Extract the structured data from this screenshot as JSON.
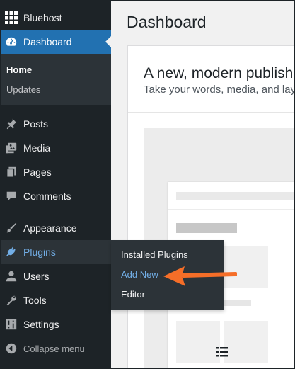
{
  "sidebar": {
    "top_item": {
      "label": "Bluehost",
      "icon": "grid-icon"
    },
    "dashboard": {
      "label": "Dashboard",
      "icon": "dashboard-gauge-icon"
    },
    "dashboard_sub": [
      {
        "label": "Home",
        "current": true
      },
      {
        "label": "Updates",
        "current": false
      }
    ],
    "items": [
      {
        "label": "Posts",
        "icon": "pin-icon"
      },
      {
        "label": "Media",
        "icon": "media-icon"
      },
      {
        "label": "Pages",
        "icon": "pages-icon"
      },
      {
        "label": "Comments",
        "icon": "comment-icon"
      },
      {
        "label": "Appearance",
        "icon": "paintbrush-icon"
      },
      {
        "label": "Plugins",
        "icon": "plug-icon"
      },
      {
        "label": "Users",
        "icon": "user-icon"
      },
      {
        "label": "Tools",
        "icon": "wrench-icon"
      },
      {
        "label": "Settings",
        "icon": "settings-icon"
      }
    ],
    "collapse": {
      "label": "Collapse menu",
      "icon": "collapse-icon"
    }
  },
  "flyout": {
    "items": [
      {
        "label": "Installed Plugins"
      },
      {
        "label": "Add New"
      },
      {
        "label": "Editor"
      }
    ]
  },
  "main": {
    "title": "Dashboard",
    "welcome_title": "A new, modern publishing experience is coming soon.",
    "welcome_sub": "Take your words, media, and layout in new directions."
  },
  "colors": {
    "sidebar_bg": "#1d2327",
    "active_bg": "#2271b1",
    "hover_bg": "#2c3338",
    "hover_text": "#72aee6",
    "arrow": "#f56e28"
  }
}
